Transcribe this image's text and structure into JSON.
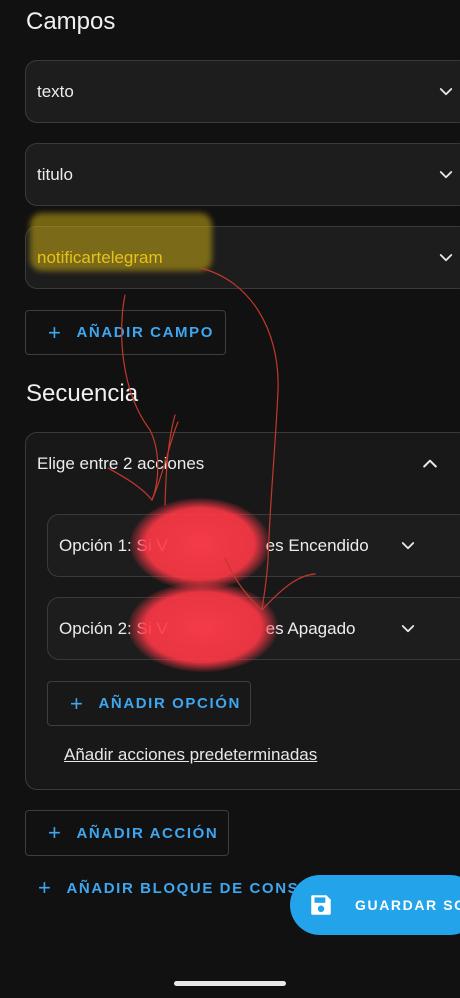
{
  "campos": {
    "title": "Campos",
    "fields": [
      {
        "label": "texto"
      },
      {
        "label": "titulo"
      },
      {
        "label": "notificartelegram"
      }
    ],
    "add_field_label": "AÑADIR CAMPO"
  },
  "secuencia": {
    "title": "Secuencia",
    "choose_header": "Elige entre 2 acciones",
    "options": [
      {
        "label": "Opción 1: Si Va... es Encendido",
        "visible_prefix": "Opción 1: Si V",
        "visible_suffix": "es Encendido"
      },
      {
        "label": "Opción 2: Si Va... es Apagado",
        "visible_prefix": "Opción 2: Si V",
        "visible_suffix": "es Apagado"
      }
    ],
    "add_option_label": "AÑADIR OPCIÓN",
    "default_actions_link": "Añadir acciones predeterminadas",
    "add_action_label": "AÑADIR ACCIÓN",
    "add_block_label": "AÑADIR BLOQUE DE CONSTR"
  },
  "fab": {
    "label": "GUARDAR SC",
    "icon": "save-icon"
  },
  "colors": {
    "accent": "#3ea7f0",
    "highlight_text": "#e7c21c",
    "background": "#111111",
    "card": "#1d1d1d"
  }
}
